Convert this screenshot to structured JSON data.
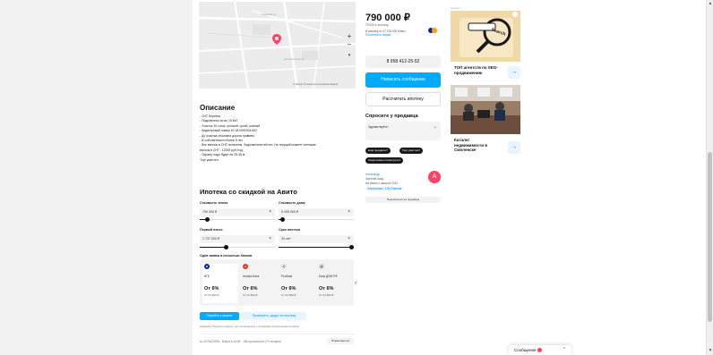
{
  "map": {
    "street_1": "Садовая ул.",
    "street_2": "Центральная ул.",
    "zoom_in": "+",
    "zoom_out": "−",
    "footer": "© Яндекс Условия использования Яндекс"
  },
  "description": {
    "title": "Описание",
    "lines": [
      "- СНТ Березка.",
      "- Подключено эл-во 15 КвТ",
      "- Участок 10 соток, угловой, сухой, ровный",
      "- Кадастровый номер 67:18:0901004:602",
      "- До участка отсыпана дорога гравием",
      "- В собственности более 5 лет",
      "- Все взносы в СНТ оплачены. Задолженностей нет. На текущий момент членские",
      "взносы в СНТ - 12000 руб./год.",
      "- Охрану, надо будет ее 25-35 м",
      "Торг уместен."
    ]
  },
  "mortgage": {
    "title": "Ипотека со скидкой на Авито",
    "land_cost_label": "Стоимость земли",
    "land_cost_value": "790 000 ₽",
    "house_cost_label": "Стоимость дома",
    "house_cost_value": "5 000 000 ₽",
    "down_payment_label": "Первый взнос",
    "down_payment_value": "1 737 000 ₽",
    "term_label": "Срок ипотеки",
    "term_value": "30 лет",
    "sliders": {
      "land_cost": 0.1,
      "house_cost": 0.05,
      "down_payment": 0.35,
      "term": 1.0
    },
    "banks_title": "Одна заявка в несколько банков",
    "banks": [
      {
        "logo": "ВТБ",
        "name": "ВТБ",
        "rate": "От 6%",
        "payment": "От 24 500 ₽",
        "color": "#0a2896"
      },
      {
        "logo": "А",
        "name": "Альфа-Банк",
        "rate": "От 6%",
        "payment": "От 24 500 ₽",
        "color": "#ef3124"
      },
      {
        "logo": "Р",
        "name": "Росбанк",
        "rate": "От 6%",
        "payment": "От 24 500 ₽",
        "color": "#e8e8e8"
      },
      {
        "logo": "Д",
        "name": "Банк ДОМ.РФ",
        "rate": "От 6%",
        "payment": "От 24 500 ₽",
        "color": "#cfcfcf"
      }
    ],
    "apply_button": "Перейти к анкете",
    "check_button": "Проверить, дадут ли ипотеку",
    "disclaimer": "Нажимая «Перейти к анкете», вы соглашаетесь с условиями использования сервиса"
  },
  "footer": {
    "meta": "№ 4076420936 · Вчера в 16:48 · 186 просмотров (+0 сегодня)",
    "complain_button": "Пожаловаться"
  },
  "seller": {
    "price": "790 000 ₽",
    "price_per": "79 000 ₽ за сотку",
    "mortgage_line": "В ипотеку от 27 234 000 ₽/мес.",
    "mortgage_link": "Посмотреть скидки",
    "phone_button": "8 958 412-25-52",
    "message_button": "Написать сообщение",
    "calc_button": "Рассчитать ипотеку",
    "ask_title": "Спросите у продавца",
    "ask_placeholder": "Здравствуйте!",
    "chips": [
      "Ещё продаёте?",
      "Торг уместен?",
      "Когда можно посмотреть?"
    ],
    "name": "Александр",
    "type": "Частное лицо",
    "since": "На Авито с августа 2013",
    "badge": "Экспертиза · 128 Ответов",
    "avatar_letter": "А",
    "subscribe_button": "Подписаться на продавца"
  },
  "ads": {
    "label": "Реклама",
    "ad1_image_text": "Search",
    "ad1_title": "ТОП агентств по SEO-продвижению",
    "ad2_title": "Каталог недвижимости в Смоленске"
  },
  "messenger": {
    "label": "Сообщения"
  }
}
